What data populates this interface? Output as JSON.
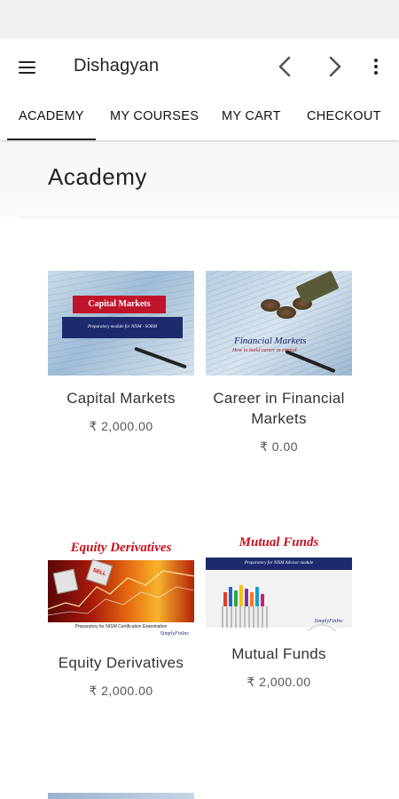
{
  "app": {
    "title": "Dishagyan"
  },
  "tabs": [
    {
      "label": "ACADEMY",
      "active": true
    },
    {
      "label": "MY COURSES",
      "active": false
    },
    {
      "label": "MY CART",
      "active": false
    },
    {
      "label": "CHECKOUT",
      "active": false
    }
  ],
  "page": {
    "title": "Academy"
  },
  "courses": [
    {
      "title": "Capital Markets",
      "price": "₹ 2,000.00",
      "thumb": {
        "banner": "Capital Markets",
        "subtitle": "Preparatory module for NISM - SORM"
      }
    },
    {
      "title": "Career in Financial Markets",
      "price": "₹ 0.00",
      "thumb": {
        "heading": "Financial Markets",
        "subtitle": "How to build career in capital"
      }
    },
    {
      "title": "Equity Derivatives",
      "price": "₹ 2,000.00",
      "thumb": {
        "heading": "Equity Derivatives",
        "dice_label": "SELL",
        "subtitle": "Preparatory for NISM Certification Examination",
        "logo": "SimplyFinInc"
      }
    },
    {
      "title": "Mutual Funds",
      "price": "₹ 2,000.00",
      "thumb": {
        "heading": "Mutual Funds",
        "subtitle": "Preparatory for NISM Advisor module",
        "logo": "SimplyFinInc"
      }
    }
  ],
  "icons": {
    "menu": "hamburger-icon",
    "back": "chevron-left-icon",
    "forward": "chevron-right-icon",
    "more": "more-vertical-icon"
  },
  "colors": {
    "accent": "#222222",
    "background": "#ffffff",
    "statusbar": "#f0f0f0"
  }
}
